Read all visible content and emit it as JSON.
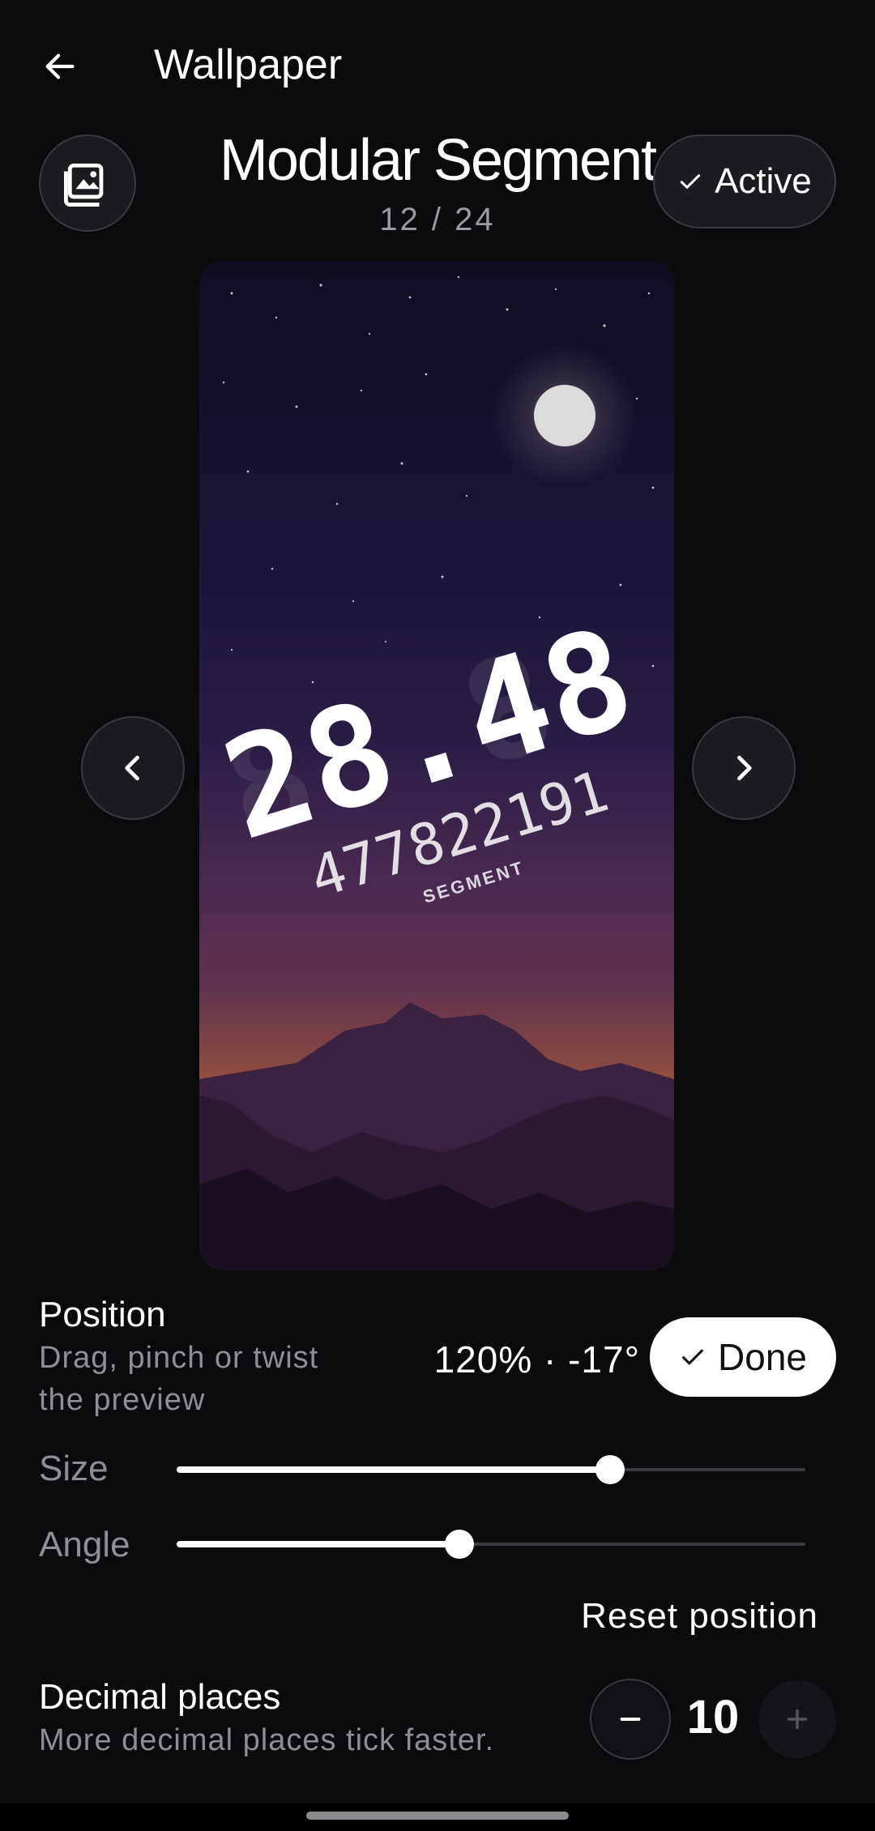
{
  "header": {
    "title": "Wallpaper",
    "back_icon": "arrow-left-icon"
  },
  "wallpaper": {
    "name": "Modular Segment",
    "counter": "12 / 24",
    "gallery_icon": "photo-library-icon",
    "active_label": "Active",
    "preview": {
      "clock_time": "28.48",
      "clock_decimals": "477822191",
      "caption": "SEGMENT"
    }
  },
  "nav": {
    "prev_icon": "chevron-left-icon",
    "next_icon": "chevron-right-icon"
  },
  "position": {
    "label": "Position",
    "help_line1": "Drag, pinch or twist",
    "help_line2": "the preview",
    "readout": "120% · -17°",
    "done_label": "Done"
  },
  "size": {
    "label": "Size",
    "value": 0.69
  },
  "angle": {
    "label": "Angle",
    "value": 0.45
  },
  "reset_label": "Reset position",
  "decimals": {
    "label": "Decimal places",
    "help": "More decimal places tick faster.",
    "value": "10"
  },
  "colors": {
    "background": "#0b0b0d",
    "surface": "#1b1c20",
    "accent": "#ffffff",
    "muted": "#8e8f94"
  }
}
